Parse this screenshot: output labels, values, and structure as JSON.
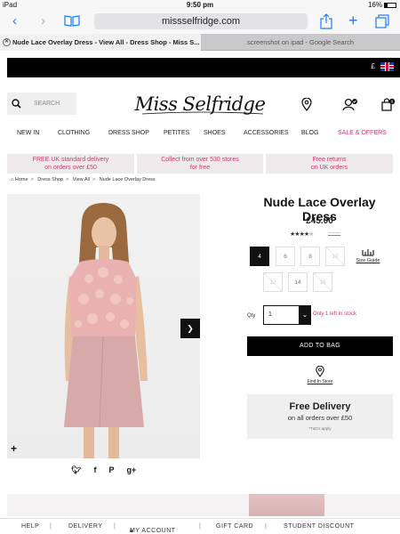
{
  "status_bar": {
    "device": "iPad",
    "time": "9:50 pm",
    "battery": "16%"
  },
  "browser": {
    "url": "missselfridge.com",
    "tabs": [
      {
        "title": "Nude Lace Overlay Dress - View All - Dress Shop - Miss S..."
      },
      {
        "title": "screenshot on ipad - Google Search"
      }
    ]
  },
  "topbar": {
    "currency": "£"
  },
  "header": {
    "search_placeholder": "SEARCH",
    "logo": "Miss Selfridge"
  },
  "nav": [
    "NEW IN",
    "CLOTHING",
    "DRESS SHOP",
    "PETITES",
    "SHOES",
    "ACCESSORIES",
    "BLOG",
    "SALE & OFFERS"
  ],
  "promos": [
    {
      "title": "FREE UK standard delivery",
      "subtitle": "on orders over £50"
    },
    {
      "title": "Collect from over 530 stores",
      "subtitle": "for free"
    },
    {
      "title": "Free returns",
      "subtitle": "on UK orders"
    }
  ],
  "breadcrumb": [
    "Home",
    "Dress Shop",
    "View All",
    "Nude Lace Overlay Dress"
  ],
  "product": {
    "name": "Nude Lace Overlay Dress",
    "price": "£45.00",
    "rating": 4,
    "rating_max": 5,
    "sizes": [
      {
        "label": "4",
        "state": "selected"
      },
      {
        "label": "6",
        "state": "available"
      },
      {
        "label": "8",
        "state": "available"
      },
      {
        "label": "10",
        "state": "unavailable"
      },
      {
        "label": "12",
        "state": "unavailable"
      },
      {
        "label": "14",
        "state": "available"
      },
      {
        "label": "16",
        "state": "unavailable"
      }
    ],
    "size_guide": "Size Guide",
    "qty_label": "Qty",
    "qty_value": "1",
    "stock_note": "Only 1 left in stock",
    "add_to_bag": "ADD TO BAG",
    "find_in_store": "Find In Store",
    "free_delivery": {
      "title": "Free Delivery",
      "subtitle": "on all orders over £50",
      "terms": "*T&Cs apply"
    }
  },
  "footer": [
    "HELP",
    "DELIVERY",
    "MY ACCOUNT",
    "GIFT CARD",
    "STUDENT DISCOUNT"
  ],
  "colors": {
    "accent_pink": "#d1386e",
    "black": "#000000",
    "ios_blue": "#1e7cf5"
  }
}
